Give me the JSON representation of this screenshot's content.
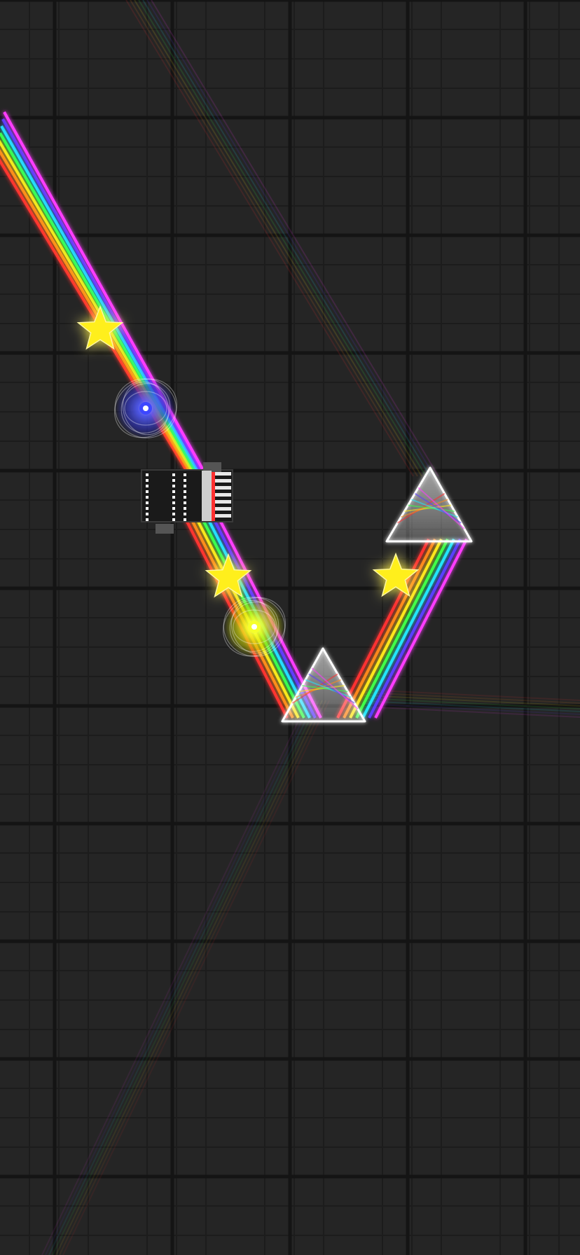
{
  "game": {
    "board": {
      "background_color": "#252525",
      "grid_major_color": "#141414",
      "grid_minor_color": "#1c1c1c"
    },
    "beam_colors": [
      "#ff3030",
      "#ff8a1e",
      "#ffe81a",
      "#3cff4a",
      "#22e6ff",
      "#5c3cff",
      "#ff3cff"
    ],
    "stars": [
      {
        "name": "star-upper-left",
        "collected": false
      },
      {
        "name": "star-middle",
        "collected": false
      },
      {
        "name": "star-right",
        "collected": false
      }
    ],
    "portals": [
      {
        "name": "portal-blue",
        "color": "#3c46ff"
      },
      {
        "name": "portal-yellow",
        "color": "#f5ff2a"
      }
    ],
    "prisms": [
      {
        "name": "prism-top-right"
      },
      {
        "name": "prism-bottom"
      }
    ],
    "emitter": {
      "name": "light-emitter"
    },
    "star_color": "#ffef1a"
  }
}
